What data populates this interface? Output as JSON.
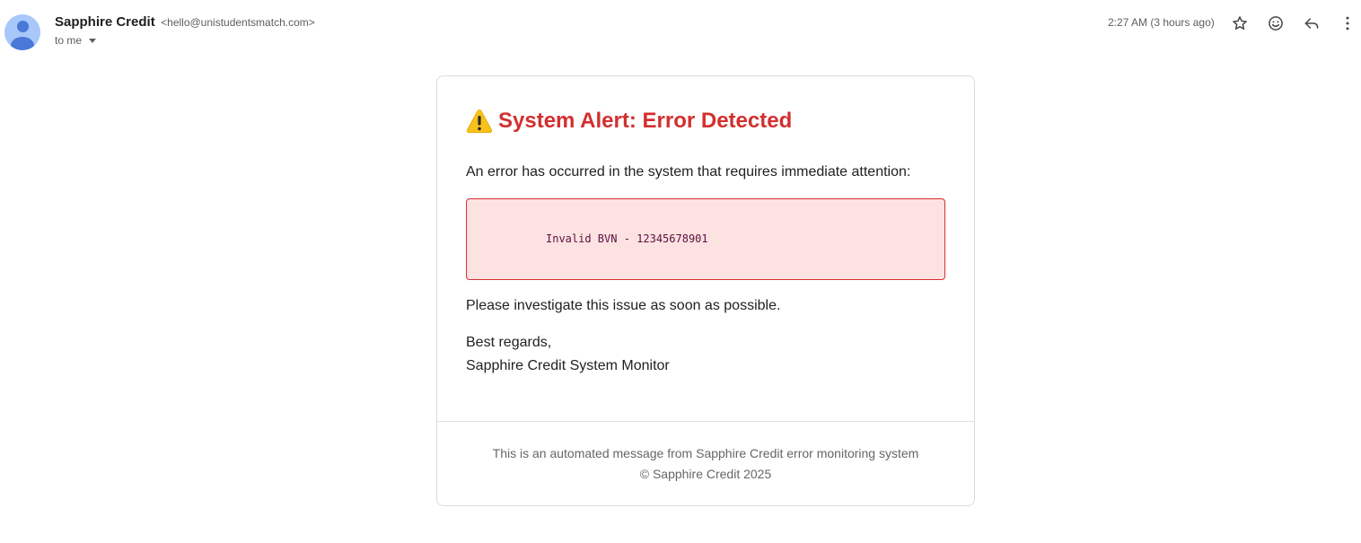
{
  "email": {
    "sender_name": "Sapphire Credit",
    "sender_email": "<hello@unistudentsmatch.com>",
    "recipient": "to me",
    "timestamp": "2:27 AM (3 hours ago)"
  },
  "icons": {
    "avatar": "person-avatar-icon",
    "star": "star-icon",
    "emoji": "emoji-smile-icon",
    "reply": "reply-icon",
    "more": "more-vertical-icon",
    "warning": "warning-icon"
  },
  "message": {
    "title": "System Alert: Error Detected",
    "intro": "An error has occurred in the system that requires immediate attention:",
    "error_detail": "Invalid BVN - 12345678901",
    "instruction": "Please investigate this issue as soon as possible.",
    "closing": "Best regards,",
    "signature": "Sapphire Credit System Monitor",
    "footer_line1": "This is an automated message from Sapphire Credit error monitoring system",
    "footer_line2": "© Sapphire Credit 2025"
  },
  "colors": {
    "alert_red": "#d32f2f",
    "error_bg": "#fde2e2",
    "avatar_bg": "#a8c7fa",
    "avatar_fg": "#4a78d6"
  }
}
